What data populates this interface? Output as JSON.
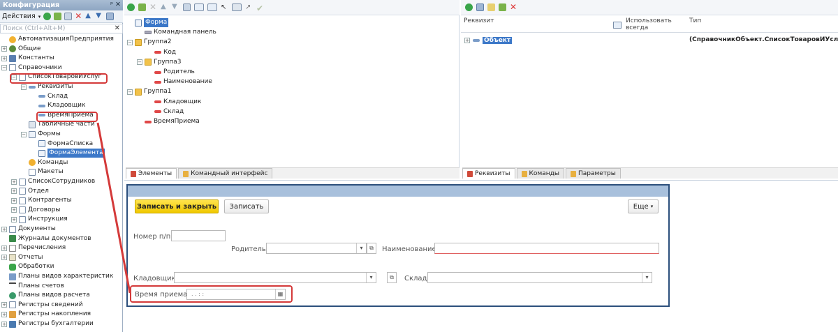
{
  "config": {
    "title": "Конфигурация",
    "title_controls": "ᵖ ✕",
    "actions_label": "Действия",
    "search_placeholder": "Поиск (Ctrl+Alt+M)",
    "tree": [
      {
        "label": "АвтоматизацияПредприятия",
        "icon": "config-root-icon",
        "level": 0,
        "exp": ""
      },
      {
        "label": "Общие",
        "icon": "common-icon",
        "level": 0,
        "exp": "+"
      },
      {
        "label": "Константы",
        "icon": "constants-icon",
        "level": 0,
        "exp": "+"
      },
      {
        "label": "Справочники",
        "icon": "catalogs-icon",
        "level": 0,
        "exp": "−"
      },
      {
        "label": "СписокТоваровИУслуг",
        "icon": "catalog-icon",
        "level": 1,
        "exp": "−"
      },
      {
        "label": "Реквизиты",
        "icon": "attributes-icon",
        "level": 2,
        "exp": "−"
      },
      {
        "label": "Склад",
        "icon": "attribute-icon",
        "level": 3,
        "exp": ""
      },
      {
        "label": "Кладовщик",
        "icon": "attribute-icon",
        "level": 3,
        "exp": ""
      },
      {
        "label": "ВремяПриема",
        "icon": "attribute-icon",
        "level": 3,
        "exp": ""
      },
      {
        "label": "Табличные части",
        "icon": "table-parts-icon",
        "level": 2,
        "exp": ""
      },
      {
        "label": "Формы",
        "icon": "forms-icon",
        "level": 2,
        "exp": "−"
      },
      {
        "label": "ФормаСписка",
        "icon": "form-icon",
        "level": 3,
        "exp": ""
      },
      {
        "label": "ФормаЭлемента",
        "icon": "form-icon",
        "level": 3,
        "exp": "",
        "selected": true
      },
      {
        "label": "Команды",
        "icon": "commands-icon",
        "level": 2,
        "exp": ""
      },
      {
        "label": "Макеты",
        "icon": "templates-icon",
        "level": 2,
        "exp": ""
      },
      {
        "label": "СписокСотрудников",
        "icon": "catalog-icon",
        "level": 1,
        "exp": "+"
      },
      {
        "label": "Отдел",
        "icon": "catalog-icon",
        "level": 1,
        "exp": "+"
      },
      {
        "label": "Контрагенты",
        "icon": "catalog-icon",
        "level": 1,
        "exp": "+"
      },
      {
        "label": "Договоры",
        "icon": "catalog-icon",
        "level": 1,
        "exp": "+"
      },
      {
        "label": "Инструкция",
        "icon": "catalog-icon",
        "level": 1,
        "exp": "+"
      },
      {
        "label": "Документы",
        "icon": "documents-icon",
        "level": 0,
        "exp": "+"
      },
      {
        "label": "Журналы документов",
        "icon": "journals-icon",
        "level": 0,
        "exp": ""
      },
      {
        "label": "Перечисления",
        "icon": "enums-icon",
        "level": 0,
        "exp": "+"
      },
      {
        "label": "Отчеты",
        "icon": "reports-icon",
        "level": 0,
        "exp": "+"
      },
      {
        "label": "Обработки",
        "icon": "dataprocessors-icon",
        "level": 0,
        "exp": ""
      },
      {
        "label": "Планы видов характеристик",
        "icon": "chart-char-icon",
        "level": 0,
        "exp": ""
      },
      {
        "label": "Планы счетов",
        "icon": "chart-accounts-icon",
        "level": 0,
        "exp": ""
      },
      {
        "label": "Планы видов расчета",
        "icon": "chart-calc-icon",
        "level": 0,
        "exp": ""
      },
      {
        "label": "Регистры сведений",
        "icon": "info-registers-icon",
        "level": 0,
        "exp": "+"
      },
      {
        "label": "Регистры накопления",
        "icon": "accum-registers-icon",
        "level": 0,
        "exp": "+"
      },
      {
        "label": "Регистры бухгалтерии",
        "icon": "acc-registers-icon",
        "level": 0,
        "exp": "+"
      }
    ]
  },
  "elements": {
    "tree": [
      {
        "label": "Форма",
        "level": 0,
        "exp": "",
        "icon": "form-icon",
        "selected": true
      },
      {
        "label": "Командная панель",
        "level": 1,
        "exp": "",
        "icon": "command-bar-icon"
      },
      {
        "label": "Группа2",
        "level": 0,
        "exp": "−",
        "icon": "folder-icon"
      },
      {
        "label": "Код",
        "level": 2,
        "exp": "",
        "icon": "field-icon"
      },
      {
        "label": "Группа3",
        "level": 1,
        "exp": "−",
        "icon": "folder-icon"
      },
      {
        "label": "Родитель",
        "level": 2,
        "exp": "",
        "icon": "field-icon"
      },
      {
        "label": "Наименование",
        "level": 2,
        "exp": "",
        "icon": "field-icon"
      },
      {
        "label": "Группа1",
        "level": 0,
        "exp": "−",
        "icon": "folder-icon"
      },
      {
        "label": "Кладовщик",
        "level": 2,
        "exp": "",
        "icon": "field-icon"
      },
      {
        "label": "Склад",
        "level": 2,
        "exp": "",
        "icon": "field-icon"
      },
      {
        "label": "ВремяПриема",
        "level": 1,
        "exp": "",
        "icon": "field-icon"
      }
    ],
    "tabs": [
      {
        "label": "Элементы",
        "active": true
      },
      {
        "label": "Командный интерфейс",
        "active": false
      }
    ]
  },
  "attributes": {
    "col_attr": "Реквизит",
    "col_use": "Использовать всегда",
    "col_type": "Тип",
    "row_name": "Объект",
    "row_type": "(СправочникОбъект.СписокТоваровИУслуг)",
    "tabs": [
      {
        "label": "Реквизиты",
        "active": true
      },
      {
        "label": "Команды",
        "active": false
      },
      {
        "label": "Параметры",
        "active": false
      }
    ]
  },
  "form": {
    "btn_save_close": "Записать и закрыть",
    "btn_save": "Записать",
    "btn_more": "Еще",
    "lbl_number": "Номер п/п:",
    "lbl_parent": "Родитель:",
    "lbl_name": "Наименование:",
    "lbl_keeper": "Кладовщик:",
    "lbl_warehouse": "Склад:",
    "lbl_time": "Время приема:",
    "time_mask": ".  .      :  :"
  },
  "colors": {
    "accent": "#3c78c8",
    "highlight": "#d43a3a",
    "save_button": "#f7d417"
  }
}
